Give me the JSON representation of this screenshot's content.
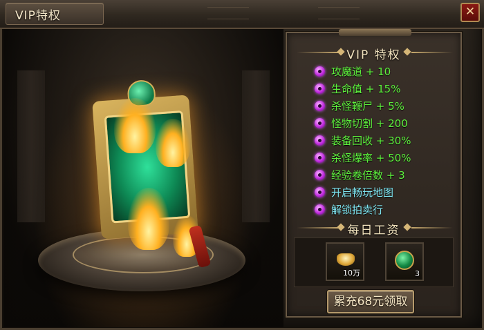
{
  "window": {
    "title": "VIP特权",
    "close_label": "✕"
  },
  "panel": {
    "heading": "VIP 特权",
    "perks": [
      {
        "text": "攻魔道 + 10",
        "color": "green"
      },
      {
        "text": "生命值 + 15%",
        "color": "green"
      },
      {
        "text": "杀怪鞭尸 + 5%",
        "color": "green"
      },
      {
        "text": "怪物切割 + 200",
        "color": "green"
      },
      {
        "text": "装备回收 + 30%",
        "color": "green"
      },
      {
        "text": "杀怪爆率 + 50%",
        "color": "green"
      },
      {
        "text": "经验卷倍数 + 3",
        "color": "green"
      },
      {
        "text": "开启畅玩地图",
        "color": "cyan"
      },
      {
        "text": "解锁拍卖行",
        "color": "cyan"
      }
    ],
    "perk_icon": "purple-gem-icon",
    "daily_heading": "每日工资",
    "rewards": [
      {
        "icon": "gold-ingot-icon",
        "count": "10万"
      },
      {
        "icon": "jade-pendant-icon",
        "count": "3"
      }
    ],
    "claim_button": "累充68元领取"
  },
  "colors": {
    "perk_green": "#5df03d",
    "perk_cyan": "#7fe6f2",
    "panel_border": "#6a5a46",
    "close_red": "#8a1a14"
  }
}
